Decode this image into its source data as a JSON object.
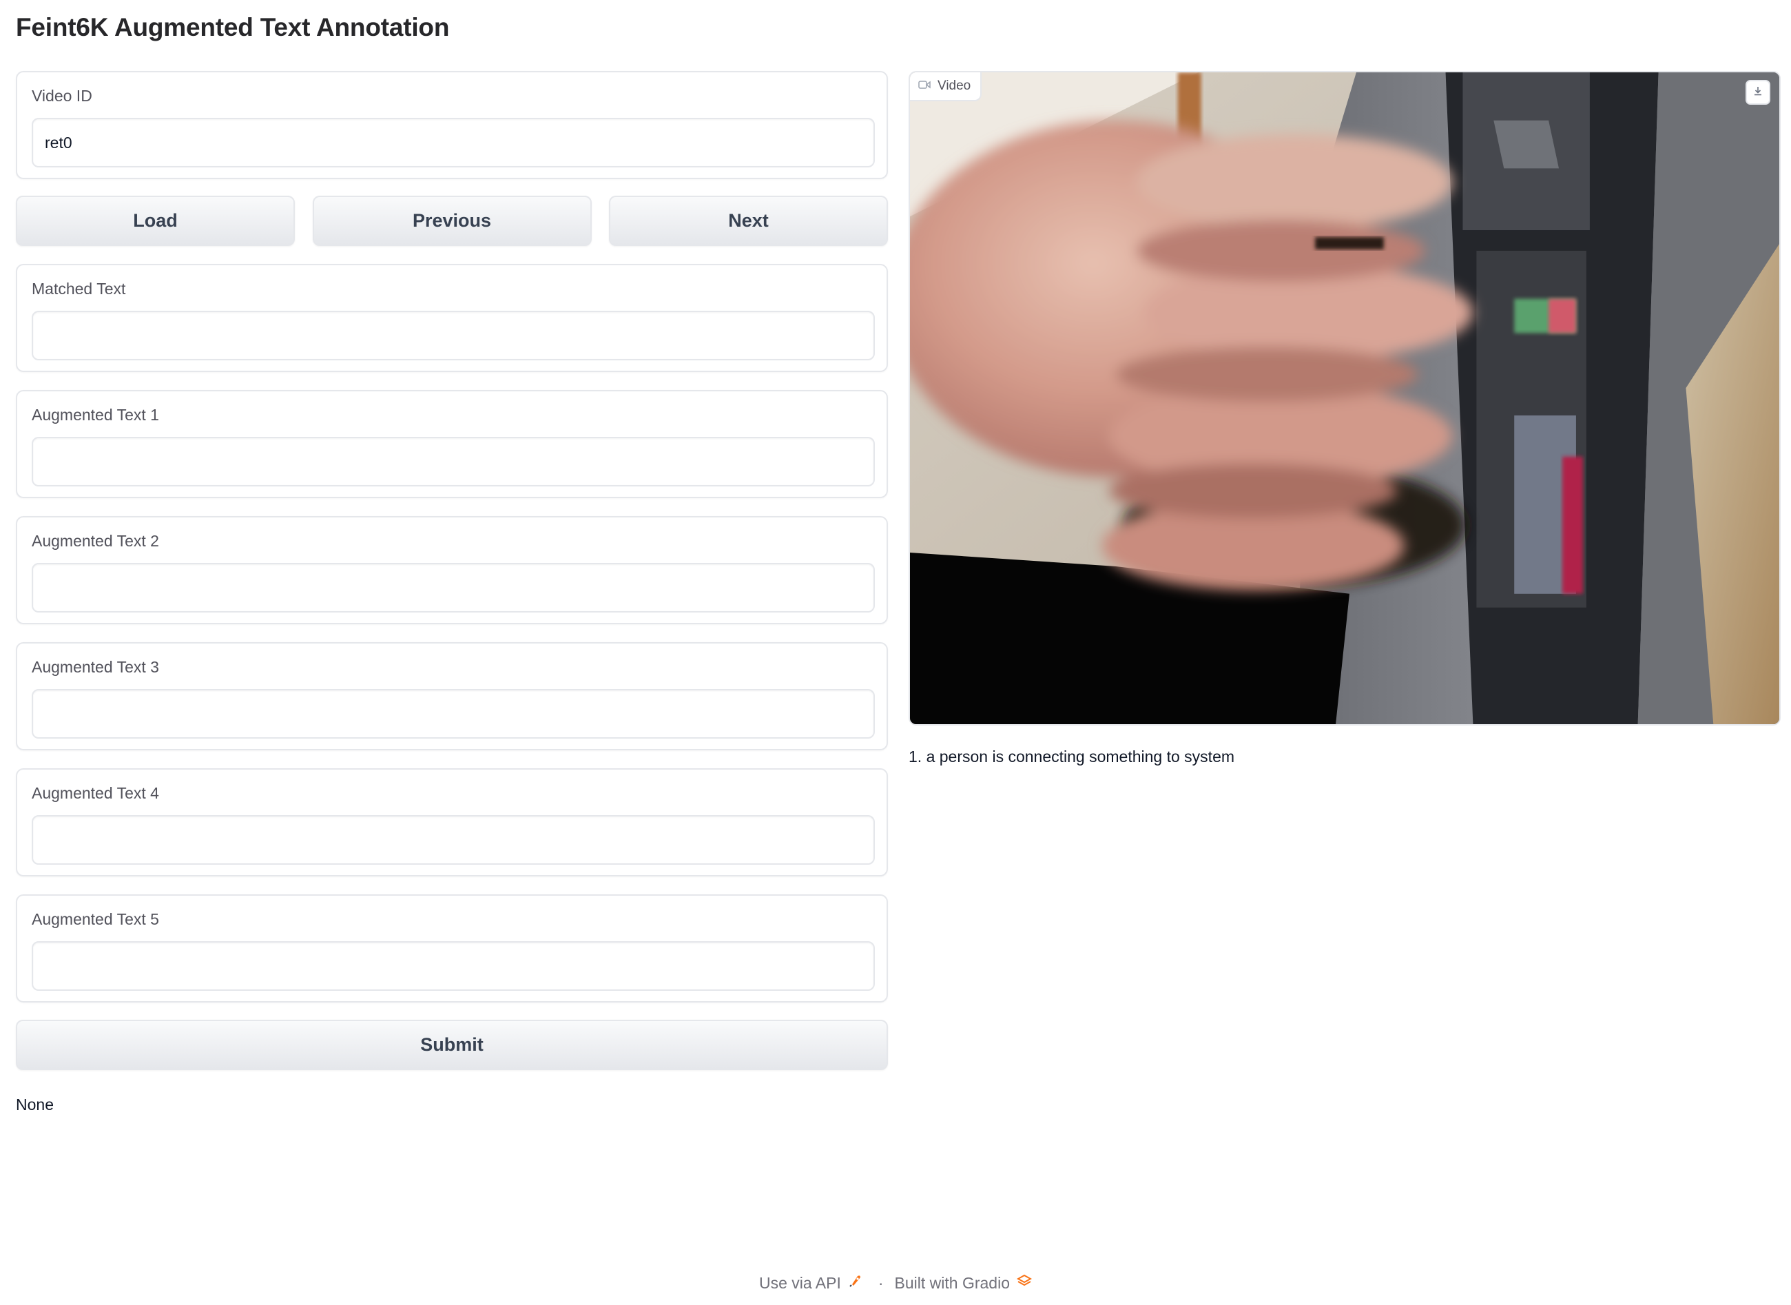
{
  "header": {
    "title": "Feint6K Augmented Text Annotation"
  },
  "form": {
    "video_id": {
      "label": "Video ID",
      "value": "ret0",
      "placeholder": ""
    },
    "buttons": {
      "load": "Load",
      "previous": "Previous",
      "next": "Next",
      "submit": "Submit"
    },
    "matched_text": {
      "label": "Matched Text",
      "value": ""
    },
    "augmented": [
      {
        "label": "Augmented Text 1",
        "value": ""
      },
      {
        "label": "Augmented Text 2",
        "value": ""
      },
      {
        "label": "Augmented Text 3",
        "value": ""
      },
      {
        "label": "Augmented Text 4",
        "value": ""
      },
      {
        "label": "Augmented Text 5",
        "value": ""
      }
    ],
    "status": "None"
  },
  "video": {
    "label": "Video",
    "icon": "video-camera-icon",
    "download_icon": "download-icon",
    "caption": "1. a person is connecting something to system"
  },
  "footer": {
    "api_link": "Use via API",
    "api_icon": "rocket-icon",
    "separator": "·",
    "built_with": "Built with Gradio",
    "gradio_icon": "gradio-logo-icon"
  },
  "colors": {
    "border": "#e5e7eb",
    "button_gradient_top": "#f9fafb",
    "button_gradient_bottom": "#e5e7eb",
    "text_muted": "#71717a",
    "gradio_orange": "#f97316"
  }
}
